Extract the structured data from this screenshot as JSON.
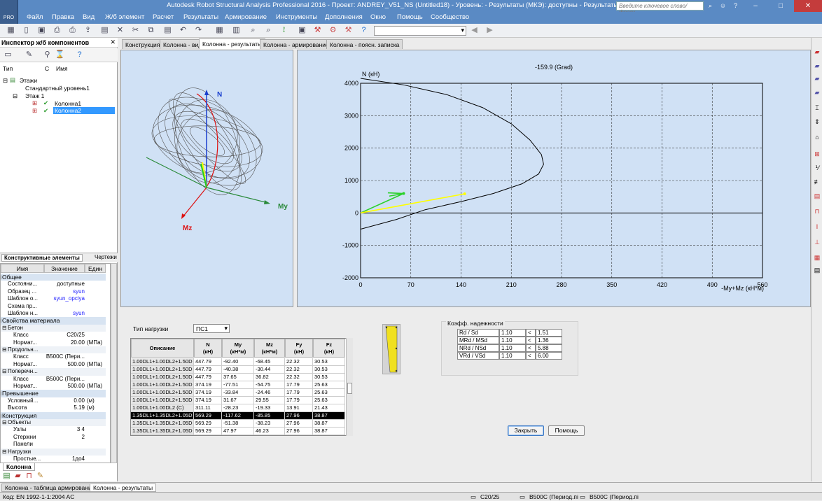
{
  "window": {
    "title": "Autodesk Robot Structural Analysis Professional 2016 - Проект: ANDREY_V51_NS (Untitled18) - Уровень: - Результаты (МКЭ): доступны - Результаты: доступные",
    "search_placeholder": "Введите ключевое слово/фразу",
    "logo_text": "PRO"
  },
  "menu": [
    "Файл",
    "Правка",
    "Вид",
    "Ж/б элемент",
    "Расчет",
    "Результаты",
    "Армирование",
    "Инструменты",
    "Дополнения",
    "Окно",
    "Помощь",
    "Сообщество"
  ],
  "inspector": {
    "title": "Инспектор ж/б компонентов",
    "close": "✕",
    "col_type": "Тип",
    "col_c": "С",
    "col_name": "Имя",
    "tree": [
      "Этажи",
      "Стандартный уровень1",
      "Этаж 1",
      "Колонна1",
      "Колонна2"
    ],
    "tab_elements": "Конструктивные элементы",
    "tab_drawings": "Чертежи",
    "props_headers": [
      "Имя",
      "Значение",
      "Един"
    ],
    "props": [
      {
        "kind": "sec",
        "name": "Общее",
        "value": "",
        "unit": ""
      },
      {
        "kind": "row",
        "name": "Состояни...",
        "value": "доступные",
        "unit": ""
      },
      {
        "kind": "row",
        "name": "Образец ...",
        "value": "syun",
        "unit": "",
        "blue": true
      },
      {
        "kind": "row",
        "name": "Шаблон о...",
        "value": "syun_opciya",
        "unit": "",
        "blue": true
      },
      {
        "kind": "row",
        "name": "Схема пр...",
        "value": "",
        "unit": ""
      },
      {
        "kind": "row",
        "name": "Шаблон н...",
        "value": "syun",
        "unit": "",
        "blue": true
      },
      {
        "kind": "sec",
        "name": "Свойства материала",
        "value": "",
        "unit": ""
      },
      {
        "kind": "sub",
        "name": "Бетон",
        "value": "",
        "unit": ""
      },
      {
        "kind": "row2",
        "name": "Класс",
        "value": "C20/25",
        "unit": ""
      },
      {
        "kind": "row2",
        "name": "Нормат...",
        "value": "20.00",
        "unit": "(МПа)"
      },
      {
        "kind": "sub",
        "name": "Продольн...",
        "value": "",
        "unit": ""
      },
      {
        "kind": "row2",
        "name": "Класс",
        "value": "B500C (Пери...",
        "unit": ""
      },
      {
        "kind": "row2",
        "name": "Нормат...",
        "value": "500.00",
        "unit": "(МПа)"
      },
      {
        "kind": "sub",
        "name": "Поперечн...",
        "value": "",
        "unit": ""
      },
      {
        "kind": "row2",
        "name": "Класс",
        "value": "B500C (Пери...",
        "unit": ""
      },
      {
        "kind": "row2",
        "name": "Нормат...",
        "value": "500.00",
        "unit": "(МПа)"
      },
      {
        "kind": "sec",
        "name": "Превышение",
        "value": "",
        "unit": ""
      },
      {
        "kind": "row",
        "name": "Условный...",
        "value": "0.00",
        "unit": "(м)"
      },
      {
        "kind": "row",
        "name": "Высота",
        "value": "5.19",
        "unit": "(м)"
      },
      {
        "kind": "sec",
        "name": "Конструкция",
        "value": "",
        "unit": ""
      },
      {
        "kind": "sub",
        "name": "Объекты",
        "value": "",
        "unit": ""
      },
      {
        "kind": "row2",
        "name": "Узлы",
        "value": "3 4",
        "unit": ""
      },
      {
        "kind": "row2",
        "name": "Стержни",
        "value": "2",
        "unit": ""
      },
      {
        "kind": "row2",
        "name": "Панели",
        "value": "",
        "unit": ""
      },
      {
        "kind": "sub",
        "name": "Нагрузки",
        "value": "",
        "unit": ""
      },
      {
        "kind": "row2",
        "name": "Простые...",
        "value": "1до4",
        "unit": ""
      }
    ],
    "bottom_tab": "Колонна"
  },
  "doc_tabs": [
    "Конструкция",
    "Колонна - вид",
    "Колонна - результаты",
    "Колонна - армирование",
    "Колонна - поясн. записка"
  ],
  "view3d": {
    "axis_n": "N",
    "axis_my": "My",
    "axis_mz": "Mz"
  },
  "chart_data": {
    "type": "line",
    "title": "-159.9 (Grad)",
    "ylabel": "N (кН)",
    "xlabel": "-My+Mz (кН*м)",
    "xlim": [
      0,
      560
    ],
    "ylim": [
      -2000,
      4000
    ],
    "x_ticks": [
      0,
      70,
      140,
      210,
      280,
      350,
      420,
      490,
      560
    ],
    "y_ticks": [
      4000,
      3000,
      2000,
      1000,
      0,
      -1000,
      -2000
    ],
    "grid": true,
    "series": [
      {
        "points": [
          [
            0,
            4150
          ],
          [
            60,
            3950
          ],
          [
            120,
            3650
          ],
          [
            170,
            3250
          ],
          [
            210,
            2750
          ],
          [
            236,
            2250
          ],
          [
            252,
            1800
          ],
          [
            255,
            1500
          ],
          [
            248,
            1200
          ],
          [
            225,
            900
          ],
          [
            185,
            600
          ],
          [
            140,
            350
          ],
          [
            90,
            100
          ],
          [
            50,
            -200
          ],
          [
            0,
            -500
          ]
        ]
      }
    ],
    "force_vectors": [
      {
        "from": [
          0,
          0
        ],
        "to": [
          60,
          600
        ]
      },
      {
        "from": [
          0,
          0
        ],
        "to": [
          145,
          590
        ]
      }
    ]
  },
  "results": {
    "load_type_label": "Тип нагрузки",
    "load_type_value": "ПС1",
    "columns": [
      {
        "h": "Описание",
        "u": ""
      },
      {
        "h": "N",
        "u": "(кН)"
      },
      {
        "h": "My",
        "u": "(кН*м)"
      },
      {
        "h": "Mz",
        "u": "(кН*м)"
      },
      {
        "h": "Fy",
        "u": "(кН)"
      },
      {
        "h": "Fz",
        "u": "(кН)"
      }
    ],
    "rows": [
      [
        "1.00DL1+1.00DL2+1.50D",
        "447.79",
        "-92.40",
        "-68.45",
        "22.32",
        "30.53"
      ],
      [
        "1.00DL1+1.00DL2+1.50D",
        "447.79",
        "-40.38",
        "-30.44",
        "22.32",
        "30.53"
      ],
      [
        "1.00DL1+1.00DL2+1.50D",
        "447.79",
        "37.65",
        "36.82",
        "22.32",
        "30.53"
      ],
      [
        "1.00DL1+1.00DL2+1.50D",
        "374.19",
        "-77.51",
        "-54.75",
        "17.79",
        "25.63"
      ],
      [
        "1.00DL1+1.00DL2+1.50D",
        "374.19",
        "-33.84",
        "-24.46",
        "17.79",
        "25.63"
      ],
      [
        "1.00DL1+1.00DL2+1.50D",
        "374.19",
        "31.67",
        "29.55",
        "17.79",
        "25.63"
      ],
      [
        "1.00DL1+1.00DL2 (C)",
        "311.11",
        "-28.23",
        "-19.33",
        "13.91",
        "21.43"
      ],
      [
        "1.35DL1+1.35DL2+1.05D",
        "569.29",
        "-117.62",
        "-85.85",
        "27.96",
        "38.87"
      ],
      [
        "1.35DL1+1.35DL2+1.05D",
        "569.29",
        "-51.38",
        "-38.23",
        "27.96",
        "38.87"
      ],
      [
        "1.35DL1+1.35DL2+1.05D",
        "569.29",
        "47.97",
        "46.23",
        "27.96",
        "38.87"
      ]
    ],
    "selected_row": 7,
    "reliability_title": "Коэфф. надежности",
    "reliability": [
      [
        "Rd / Sd",
        "1.10",
        "<",
        "1.51"
      ],
      [
        "MRd / MSd",
        "1.10",
        "<",
        "1.36"
      ],
      [
        "NRd / NSd",
        "1.10",
        "<",
        "5.88"
      ],
      [
        "VRd / VSd",
        "1.10",
        "<",
        "6.00"
      ]
    ],
    "close_button": "Закрыть",
    "help_button": "Помощь"
  },
  "window_tabs": [
    "Колонна - таблица армирования",
    "Колонна - результаты"
  ],
  "status": {
    "code": "Код: EN 1992-1-1:2004 AC",
    "concrete": "C20/25",
    "steel1": "B500C (Период.пі",
    "steel2": "B500C (Период.пі"
  },
  "colors": {
    "title_bar": "#5a8ac4",
    "view_bg": "#d0e1f5",
    "selection": "#3399ff"
  }
}
